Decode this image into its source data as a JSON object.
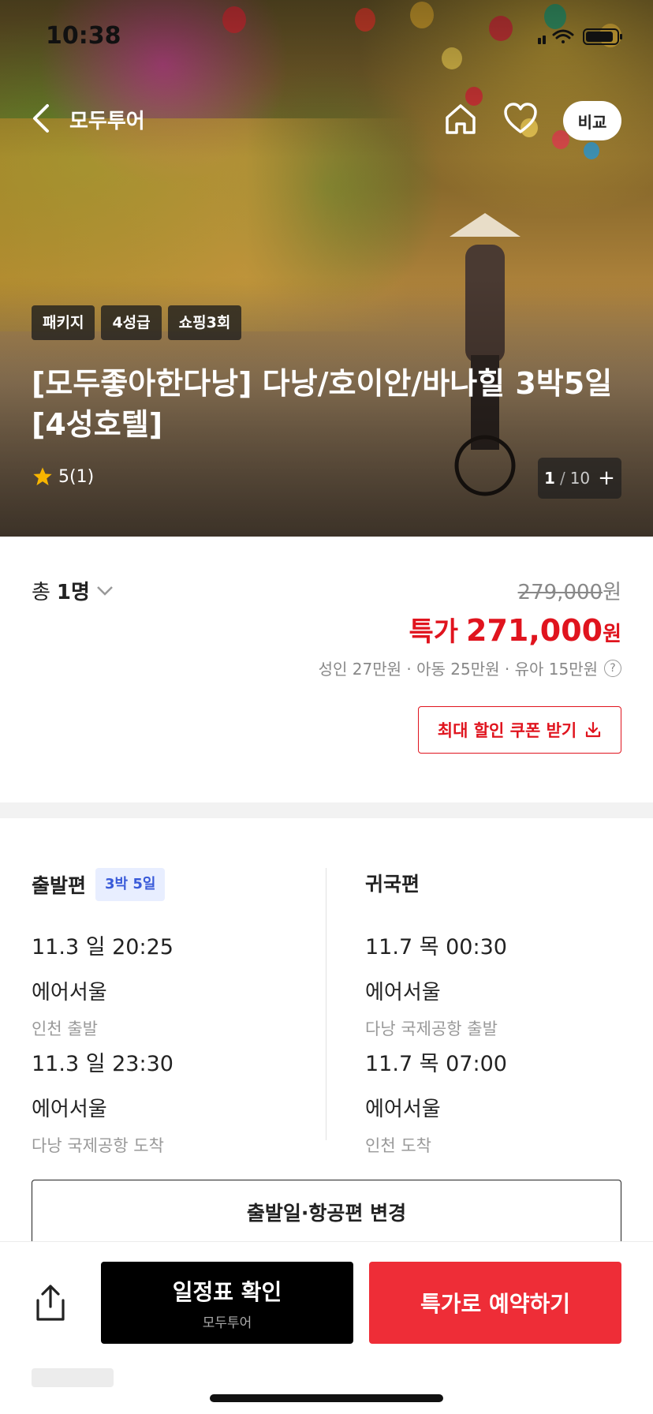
{
  "status_bar": {
    "time": "10:38"
  },
  "nav": {
    "back_label": "모두투어",
    "compare_label": "비교"
  },
  "hero": {
    "tags": [
      "패키지",
      "4성급",
      "쇼핑3회"
    ],
    "title": "[모두좋아한다낭] 다낭/호이안/바나힐 3박5일 [4성호텔]",
    "rating": "5(1)",
    "photo_counter": {
      "current": "1",
      "separator": "/",
      "total": "10",
      "plus": "+"
    }
  },
  "price": {
    "people_prefix": "총",
    "people_count": "1명",
    "original": "279,000",
    "original_unit": "원",
    "sale_label": "특가",
    "sale_price": "271,000",
    "sale_unit": "원",
    "breakdown": "성인 27만원 · 아동 25만원 · 유아 15만원",
    "help_icon_glyph": "?",
    "coupon_button": "최대 할인 쿠폰 받기"
  },
  "flights": {
    "departure": {
      "heading": "출발편",
      "badge": "3박 5일",
      "segments": [
        {
          "time": "11.3 일 20:25",
          "airline": "에어서울",
          "place": "인천 출발"
        },
        {
          "time": "11.3 일 23:30",
          "airline": "에어서울",
          "place": "다낭 국제공항 도착"
        }
      ]
    },
    "return": {
      "heading": "귀국편",
      "segments": [
        {
          "time": "11.7 목 00:30",
          "airline": "에어서울",
          "place": "다낭 국제공항 출발"
        },
        {
          "time": "11.7 목 07:00",
          "airline": "에어서울",
          "place": "인천 도착"
        }
      ]
    },
    "change_button": "출발일·항공편 변경"
  },
  "bottom_bar": {
    "schedule_button": "일정표 확인",
    "schedule_sub": "모두투어",
    "book_button": "특가로 예약하기"
  },
  "colors": {
    "accent_red": "#e0141e",
    "book_red": "#ee2d37",
    "badge_blue": "#3a5bd9"
  },
  "icons": [
    "back-arrow-icon",
    "home-icon",
    "heart-icon",
    "star-icon",
    "chevron-down-icon",
    "help-icon",
    "download-icon",
    "share-icon",
    "wifi-icon",
    "battery-icon",
    "signal-icon"
  ]
}
